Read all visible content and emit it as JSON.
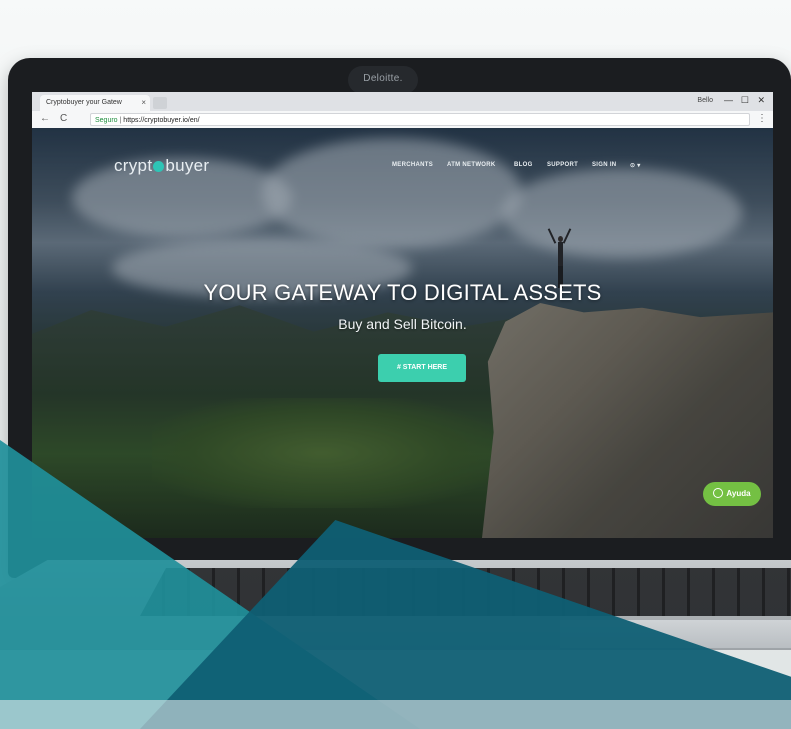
{
  "device": {
    "brand_label": "Deloitte."
  },
  "browser": {
    "tab_title": "Cryptobuyer your Gatew",
    "tab_close": "×",
    "user_label": "Bello",
    "window_controls": [
      "—",
      "☐",
      "✕"
    ],
    "nav_back": "←",
    "nav_reload": "C",
    "secure_label": "Seguro",
    "url": "https://cryptobuyer.io/en/",
    "menu": "⋮"
  },
  "site": {
    "logo_prefix": "crypt",
    "logo_suffix": "buyer",
    "nav_items": [
      "MERCHANTS",
      "ATM NETWORK",
      "BLOG",
      "SUPPORT",
      "SIGN IN",
      "⊙ ▾"
    ],
    "hero_title": "YOUR GATEWAY TO DIGITAL ASSETS",
    "hero_subtitle": "Buy and Sell Bitcoin.",
    "cta_label": "# START HERE",
    "help_label": "Ayuda"
  },
  "colors": {
    "accent_teal": "#3ccfae",
    "help_green": "#74c043",
    "brand_teal_dark": "#0f5f74",
    "brand_teal_light": "#1f8f9a"
  }
}
